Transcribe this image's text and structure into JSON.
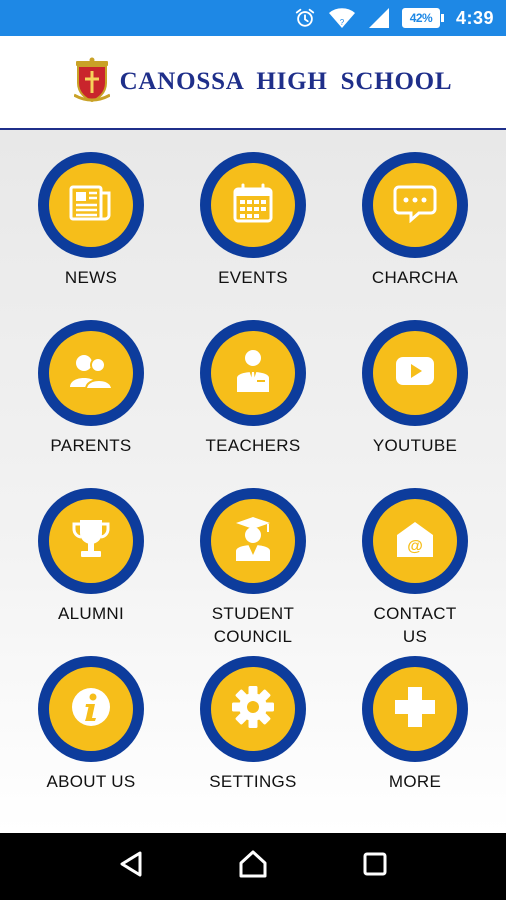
{
  "status_bar": {
    "battery_percent": "42%",
    "time": "4:39",
    "icons": [
      "alarm-icon",
      "wifi-icon",
      "signal-icon",
      "battery-icon"
    ],
    "background_color": "#1e88e5"
  },
  "header": {
    "school_name": "CANOSSA HIGH SCHOOL",
    "brand_color": "#1f2f8a"
  },
  "menu": {
    "circle_outer_color": "#0d3c9c",
    "circle_inner_color": "#f6be1a",
    "items": [
      {
        "label": "NEWS",
        "icon": "newspaper-icon"
      },
      {
        "label": "EVENTS",
        "icon": "calendar-icon"
      },
      {
        "label": "CHARCHA",
        "icon": "chat-bubble-icon"
      },
      {
        "label": "PARENTS",
        "icon": "parents-icon"
      },
      {
        "label": "TEACHERS",
        "icon": "teacher-icon"
      },
      {
        "label": "YOUTUBE",
        "icon": "youtube-icon"
      },
      {
        "label": "ALUMNI",
        "icon": "trophy-icon"
      },
      {
        "label": "STUDENT COUNCIL",
        "icon": "graduate-icon"
      },
      {
        "label": "CONTACT US",
        "icon": "email-icon"
      },
      {
        "label": "ABOUT US",
        "icon": "info-icon"
      },
      {
        "label": "SETTINGS",
        "icon": "gear-icon"
      },
      {
        "label": "MORE",
        "icon": "plus-icon"
      }
    ]
  },
  "nav_bar": {
    "buttons": [
      "back-icon",
      "home-icon",
      "recents-icon"
    ]
  }
}
